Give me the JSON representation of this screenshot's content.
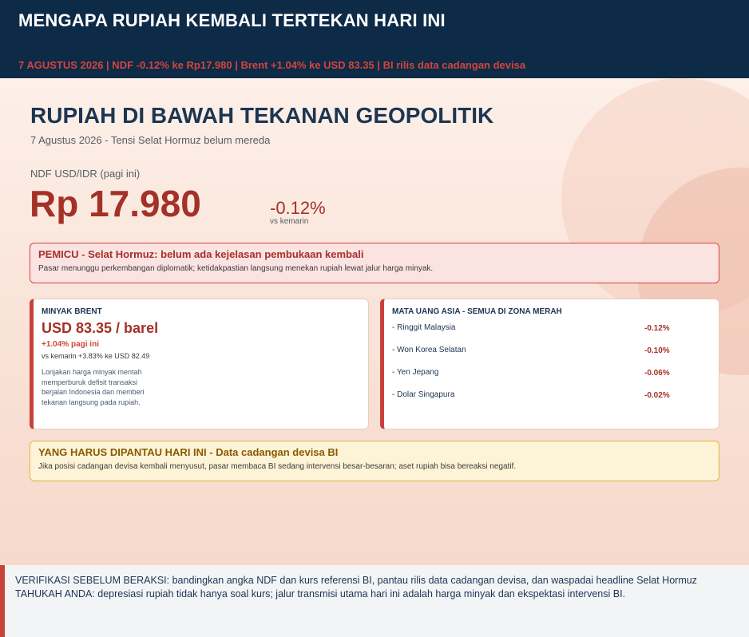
{
  "header": {
    "title": "MENGAPA RUPIAH KEMBALI TERTEKAN HARI INI",
    "ticker": "7 AGUSTUS 2026  |  NDF -0.12% ke Rp17.980  |  Brent +1.04% ke USD 83.35  |  BI rilis data cadangan devisa"
  },
  "hero": {
    "headline": "RUPIAH DI BAWAH TEKANAN GEOPOLITIK",
    "dateline": "7 Agustus 2026  -  Tensi Selat Hormuz belum mereda",
    "ndf_label": "NDF USD/IDR (pagi ini)",
    "ndf_value": "Rp 17.980",
    "ndf_change": "-0.12%",
    "ndf_change_sub": "vs  kemarin"
  },
  "trigger": {
    "title": "PEMICU  -  Selat Hormuz: belum ada kejelasan pembukaan kembali",
    "text": "Pasar menunggu perkembangan diplomatik; ketidakpastian langsung menekan rupiah lewat jalur harga minyak."
  },
  "brent": {
    "title": "MINYAK BRENT",
    "price": "USD 83.35 / barel",
    "change": "+1.04% pagi ini",
    "vs": "vs kemarin +3.83% ke USD 82.49",
    "description": "Lonjakan harga minyak mentah memperburuk defisit transaksi berjalan Indonesia dan memberi tekanan langsung pada rupiah."
  },
  "asia": {
    "title": "MATA UANG ASIA  -  SEMUA DI ZONA MERAH",
    "currencies": [
      {
        "name": "- Ringgit Malaysia",
        "change": "-0.12%"
      },
      {
        "name": "- Won Korea Selatan",
        "change": "-0.10%"
      },
      {
        "name": "- Yen Jepang",
        "change": "-0.06%"
      },
      {
        "name": "- Dolar Singapura",
        "change": "-0.02%"
      }
    ]
  },
  "watch": {
    "title": "YANG HARUS DIPANTAU HARI INI  -  Data cadangan devisa BI",
    "text": "Jika posisi cadangan devisa kembali menyusut, pasar membaca BI sedang intervensi besar-besaran; aset rupiah bisa bereaksi negatif."
  },
  "footer": {
    "verify": "VERIFIKASI SEBELUM BERAKSI: bandingkan angka NDF dan kurs referensi BI, pantau rilis data cadangan devisa, dan waspadai headline Selat Hormuz",
    "did_you_know": "TAHUKAH ANDA: depresiasi rupiah tidak hanya soal kurs; jalur transmisi utama hari ini adalah harga minyak dan ekspektasi intervensi BI."
  },
  "colors": {
    "navy": "#0d2a47",
    "accent_red": "#d4453b",
    "dark_red": "#a43128",
    "trigger_bg": "#fbe3e2",
    "watch_bg": "#fdf4d7",
    "watch_border": "#e0b33e",
    "watch_title": "#8a5a00"
  }
}
